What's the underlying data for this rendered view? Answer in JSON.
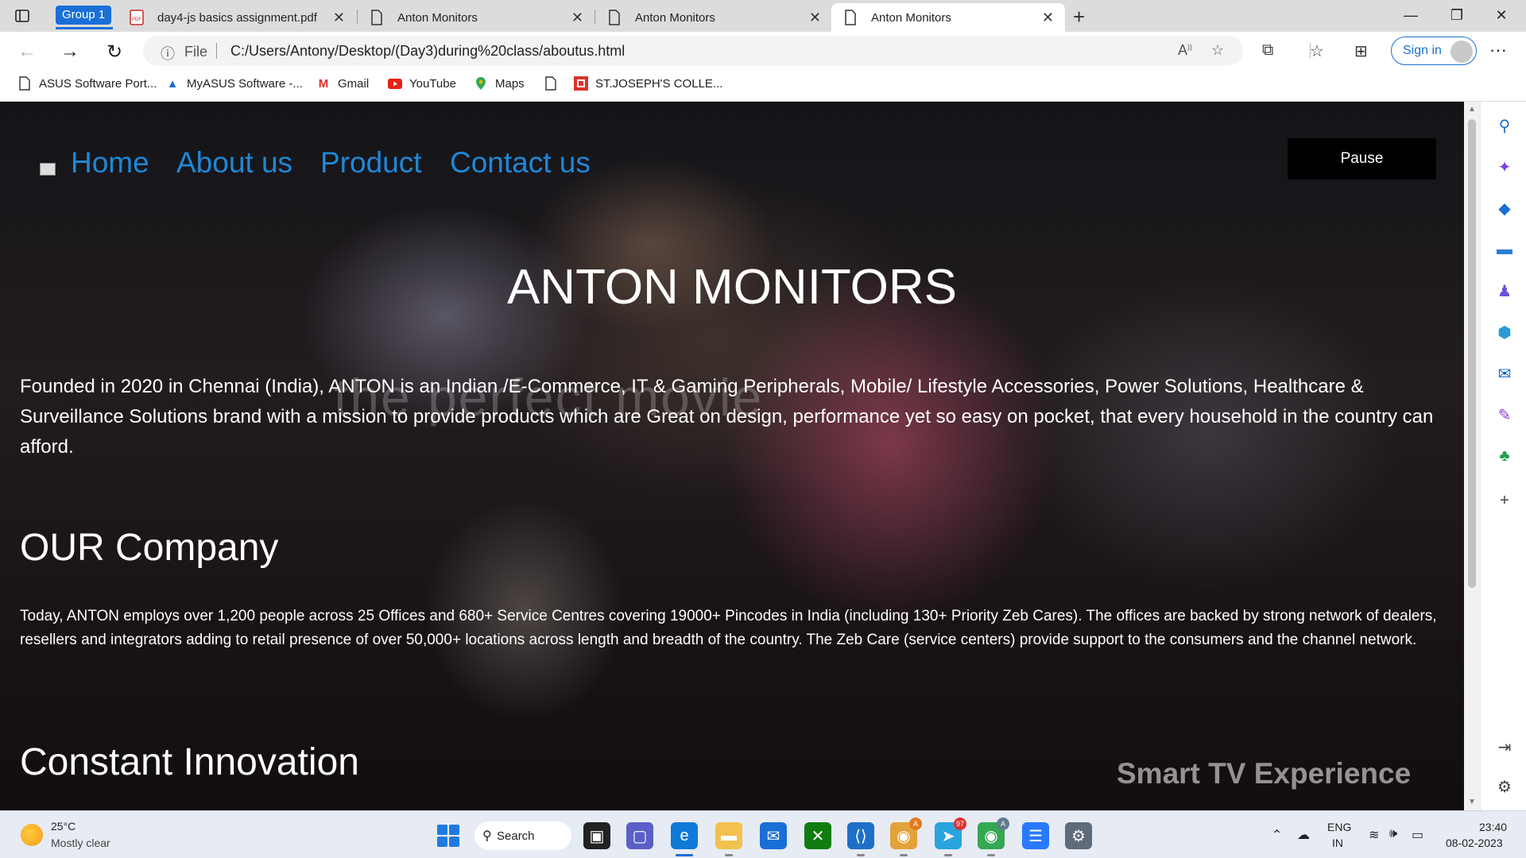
{
  "browser": {
    "tab_group_label": "Group 1",
    "tabs": [
      {
        "title": "day4-js basics assignment.pdf",
        "icon": "pdf-icon"
      },
      {
        "title": "Anton Monitors",
        "icon": "page-icon"
      },
      {
        "title": "Anton Monitors",
        "icon": "page-icon"
      },
      {
        "title": "Anton Monitors",
        "icon": "page-icon",
        "active": true
      }
    ],
    "address": {
      "scheme_label": "File",
      "url": "C:/Users/Antony/Desktop/(Day3)during%20class/aboutus.html"
    },
    "signin_label": "Sign in",
    "favorites": [
      {
        "label": "ASUS Software Port...",
        "icon": "page-icon"
      },
      {
        "label": "MyASUS Software -...",
        "icon": "asus-icon"
      },
      {
        "label": "Gmail",
        "icon": "gmail-icon"
      },
      {
        "label": "YouTube",
        "icon": "youtube-icon"
      },
      {
        "label": "Maps",
        "icon": "maps-icon"
      },
      {
        "label": "",
        "icon": "page-icon"
      },
      {
        "label": "ST.JOSEPH'S COLLE...",
        "icon": "college-icon"
      }
    ]
  },
  "site": {
    "nav": [
      "Home",
      "About us",
      "Product",
      "Contact us"
    ],
    "pause_label": "Pause",
    "title": "ANTON MONITORS",
    "intro": "Founded in 2020 in Chennai (India), ANTON is an Indian /E-Commerce, IT & Gaming Peripherals, Mobile/ Lifestyle Accessories, Power Solutions, Healthcare & Surveillance Solutions brand with a mission to provide products which are Great on design, performance yet so easy on pocket, that every household in the country can afford.",
    "company_heading": "OUR Company",
    "company_text": "Today, ANTON employs over 1,200 people across 25 Offices and 680+ Service Centres covering 19000+ Pincodes in India (including 130+ Priority Zeb Cares). The offices are backed by strong network of dealers, resellers and integrators adding to retail presence of over 50,000+ locations across length and breadth of the country. The Zeb Care (service centers) provide support to the consumers and the channel network.",
    "innovation_heading": "Constant Innovation",
    "video_watermark": "the perfect movie",
    "video_caption": "Smart TV Experience"
  },
  "taskbar": {
    "weather_temp": "25°C",
    "weather_desc": "Mostly clear",
    "search_label": "Search",
    "telegram_badge": "97",
    "lang_line1": "ENG",
    "lang_line2": "IN",
    "time": "23:40",
    "date": "08-02-2023"
  },
  "colors": {
    "nav_link": "#1e88d8",
    "accent": "#1a6fd6"
  }
}
